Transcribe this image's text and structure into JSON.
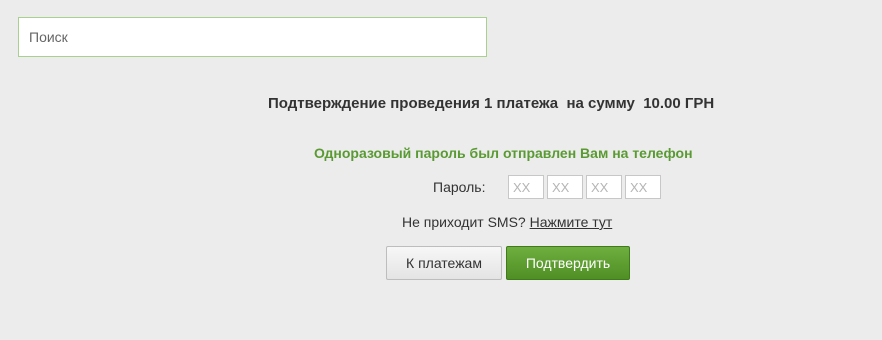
{
  "search": {
    "placeholder": "Поиск",
    "value": ""
  },
  "confirmation": {
    "title": "Подтверждение проведения 1 платежа  на сумму  10.00 ГРН",
    "notice": "Одноразовый пароль был отправлен Вам на телефон",
    "password_label": "Пароль:",
    "otp_fields": [
      {
        "placeholder": "XX",
        "value": ""
      },
      {
        "placeholder": "XX",
        "value": ""
      },
      {
        "placeholder": "XX",
        "value": ""
      },
      {
        "placeholder": "XX",
        "value": ""
      }
    ],
    "sms_prompt": "Не приходит SMS?",
    "sms_link": "Нажмите тут"
  },
  "buttons": {
    "back_label": "К платежам",
    "confirm_label": "Подтвердить"
  },
  "colors": {
    "background": "#ececec",
    "accent_green": "#5a9a32",
    "search_border": "#a9d18e",
    "confirm_button": "#5a9a32"
  }
}
